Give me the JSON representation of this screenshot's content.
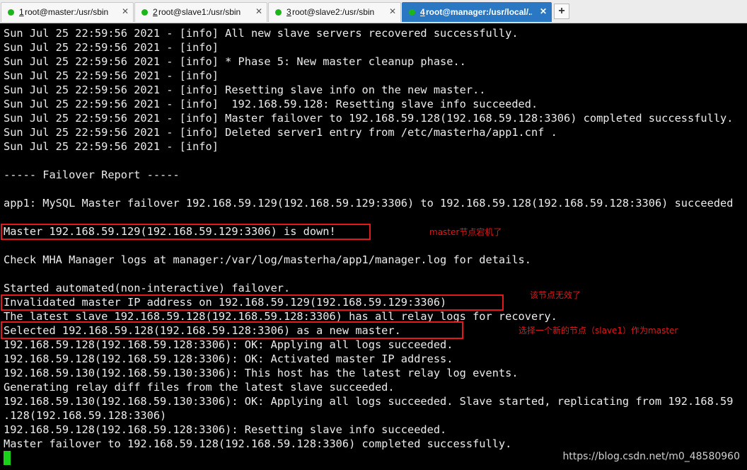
{
  "tabs": [
    {
      "num": "1",
      "label": " root@master:/usr/sbin",
      "close": "✕",
      "active": false
    },
    {
      "num": "2",
      "label": " root@slave1:/usr/sbin",
      "close": "✕",
      "active": false
    },
    {
      "num": "3",
      "label": " root@slave2:/usr/sbin",
      "close": "✕",
      "active": false
    },
    {
      "num": "4",
      "label": " root@manager:/usr/local/...",
      "close": "✕",
      "active": true
    }
  ],
  "new_tab_label": "+",
  "terminal": {
    "lines": [
      "Sun Jul 25 22:59:56 2021 - [info] All new slave servers recovered successfully.",
      "Sun Jul 25 22:59:56 2021 - [info]",
      "Sun Jul 25 22:59:56 2021 - [info] * Phase 5: New master cleanup phase..",
      "Sun Jul 25 22:59:56 2021 - [info]",
      "Sun Jul 25 22:59:56 2021 - [info] Resetting slave info on the new master..",
      "Sun Jul 25 22:59:56 2021 - [info]  192.168.59.128: Resetting slave info succeeded.",
      "Sun Jul 25 22:59:56 2021 - [info] Master failover to 192.168.59.128(192.168.59.128:3306) completed successfully.",
      "Sun Jul 25 22:59:56 2021 - [info] Deleted server1 entry from /etc/masterha/app1.cnf .",
      "Sun Jul 25 22:59:56 2021 - [info]",
      "",
      "----- Failover Report -----",
      "",
      "app1: MySQL Master failover 192.168.59.129(192.168.59.129:3306) to 192.168.59.128(192.168.59.128:3306) succeeded",
      "",
      "Master 192.168.59.129(192.168.59.129:3306) is down!",
      "",
      "Check MHA Manager logs at manager:/var/log/masterha/app1/manager.log for details.",
      "",
      "Started automated(non-interactive) failover.",
      "Invalidated master IP address on 192.168.59.129(192.168.59.129:3306)",
      "The latest slave 192.168.59.128(192.168.59.128:3306) has all relay logs for recovery.",
      "Selected 192.168.59.128(192.168.59.128:3306) as a new master.",
      "192.168.59.128(192.168.59.128:3306): OK: Applying all logs succeeded.",
      "192.168.59.128(192.168.59.128:3306): OK: Activated master IP address.",
      "192.168.59.130(192.168.59.130:3306): This host has the latest relay log events.",
      "Generating relay diff files from the latest slave succeeded.",
      "192.168.59.130(192.168.59.130:3306): OK: Applying all logs succeeded. Slave started, replicating from 192.168.59",
      ".128(192.168.59.128:3306)",
      "192.168.59.128(192.168.59.128:3306): Resetting slave info succeeded.",
      "Master failover to 192.168.59.128(192.168.59.128:3306) completed successfully."
    ]
  },
  "annotations": {
    "master_down": "master节点宕机了",
    "invalidated": "该节点无效了",
    "selected": "选择一个新的节点（slave1）作为master"
  },
  "watermark": "https://blog.csdn.net/m0_48580960",
  "colors": {
    "terminal_bg": "#000000",
    "terminal_fg": "#ececec",
    "highlight": "#e0191a",
    "cursor": "#19d219",
    "active_tab": "#2a78c4",
    "status_dot": "#1cb51c"
  }
}
